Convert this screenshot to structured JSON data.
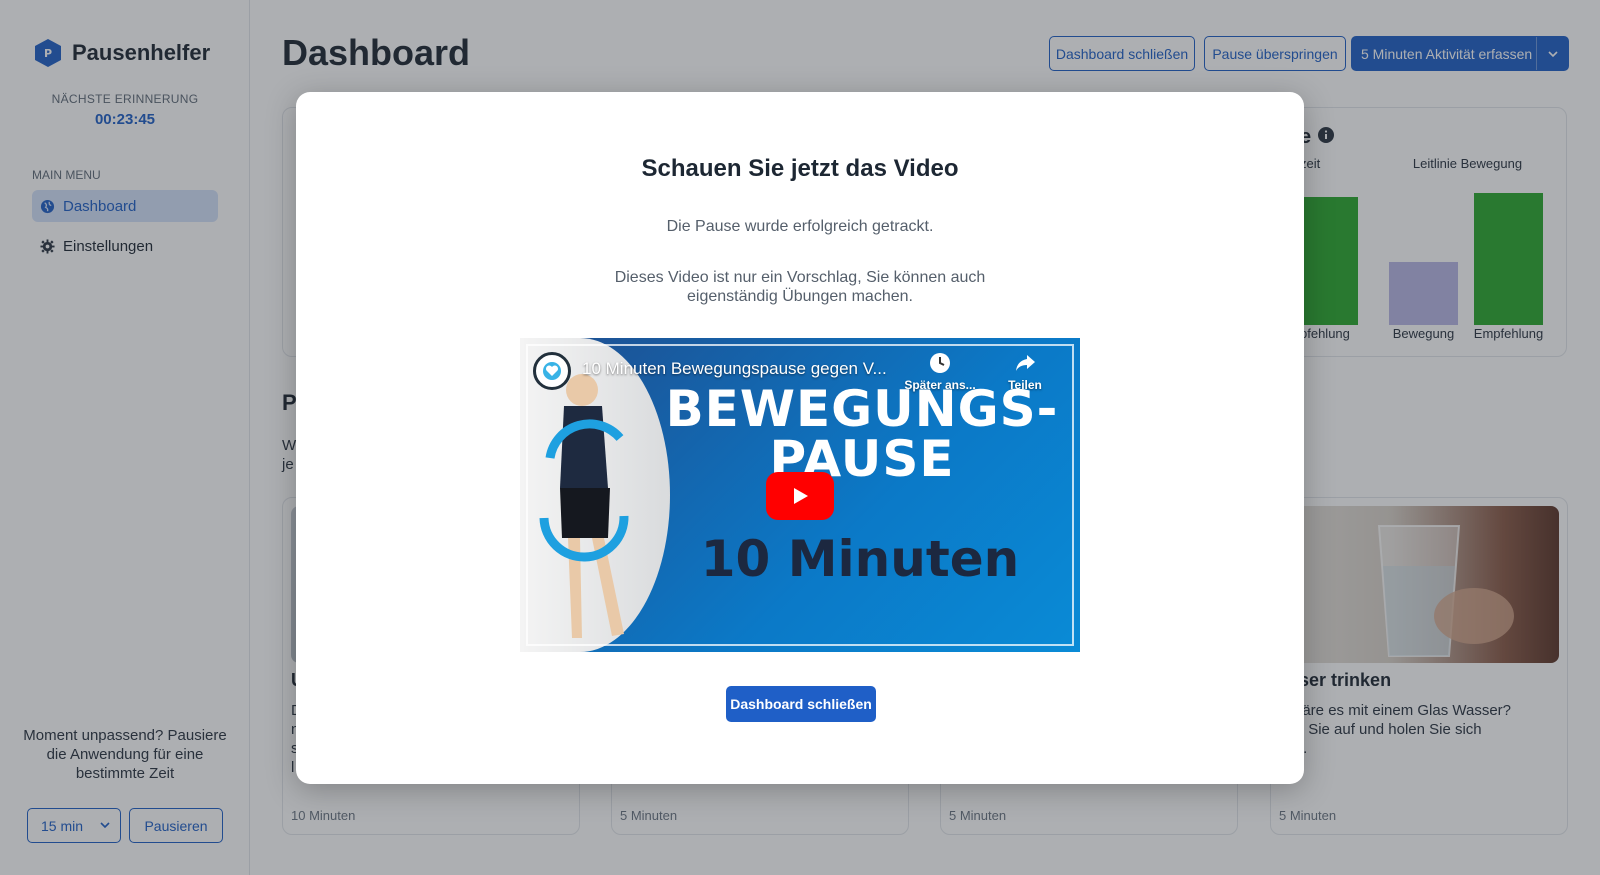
{
  "app": {
    "name": "Pausenhelfer",
    "next_reminder_label": "NÄCHSTE ERINNERUNG",
    "next_reminder_time": "00:23:45"
  },
  "sidebar": {
    "menu_label": "MAIN MENU",
    "items": [
      {
        "label": "Dashboard",
        "icon": "globe-icon",
        "active": true
      },
      {
        "label": "Einstellungen",
        "icon": "gear-icon",
        "active": false
      }
    ],
    "pause_text": "Moment unpassend? Pausiere die Anwendung für eine bestimmte Zeit",
    "pause_select_value": "15 min",
    "pause_button": "Pausieren"
  },
  "header": {
    "title": "Dashboard",
    "close_dashboard": "Dashboard schließen",
    "skip_pause": "Pause überspringen",
    "log_activity": "5 Minuten Aktivität erfassen"
  },
  "chart": {
    "title_fragment": "e",
    "head_left_fragment": "zeit",
    "head_right": "Leitlinie Bewegung",
    "label_left_fragment": "pfehlung",
    "label_mid": "Bewegung",
    "label_right": "Empfehlung",
    "colors": {
      "green": "#2aa82e",
      "lavender": "#b9b6e6"
    }
  },
  "section": {
    "title_fragment": "P",
    "desc_fragment_1": "W",
    "desc_fragment_2": "je"
  },
  "activities": [
    {
      "title_fragment": "U",
      "desc_fragments": [
        "D",
        "n",
        "s",
        "l"
      ],
      "duration": "10 Minuten"
    },
    {
      "title_fragment": "",
      "desc_fragments": [],
      "duration": "5 Minuten"
    },
    {
      "title_fragment": "",
      "desc_fragments": [],
      "duration": "5 Minuten"
    },
    {
      "title_fragment": "asser trinken",
      "desc_fragments": [
        "e wäre es mit einem Glas Wasser?",
        "hen Sie auf und holen Sie sich",
        "ken."
      ],
      "duration": "5 Minuten"
    }
  ],
  "modal": {
    "title": "Schauen Sie jetzt das Video",
    "subtitle": "Die Pause wurde erfolgreich getrackt.",
    "hint": "Dieses Video ist nur ein Vorschlag, Sie können auch eigenständig Übungen machen.",
    "video": {
      "title": "10 Minuten Bewegungspause gegen V...",
      "watch_later": "Später ans...",
      "share": "Teilen",
      "headline_1": "BEWEGUNGS-",
      "headline_2": "PAUSE",
      "headline_3": "10 Minuten"
    },
    "close_button": "Dashboard schließen"
  },
  "colors": {
    "accent": "#1f5fc7",
    "overlay": "rgba(40,45,52,0.38)"
  }
}
